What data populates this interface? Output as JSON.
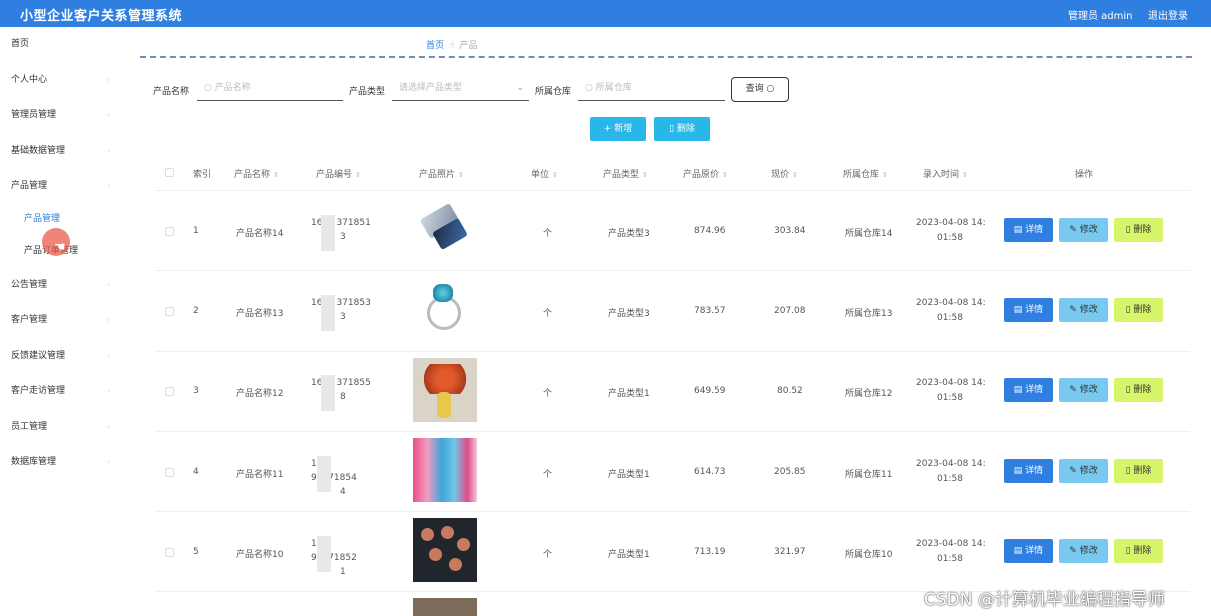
{
  "app": {
    "title": "小型企业客户关系管理系统",
    "admin_label": "管理员 admin",
    "logout_label": "退出登录"
  },
  "sidebar": {
    "items": [
      {
        "label": "首页"
      },
      {
        "label": "个人中心"
      },
      {
        "label": "管理员管理"
      },
      {
        "label": "基础数据管理"
      },
      {
        "label": "产品管理"
      },
      {
        "label": "产品管理"
      },
      {
        "label": "产品订单管理"
      },
      {
        "label": "公告管理"
      },
      {
        "label": "客户管理"
      },
      {
        "label": "反馈建议管理"
      },
      {
        "label": "客户走访管理"
      },
      {
        "label": "员工管理"
      },
      {
        "label": "数据库管理"
      }
    ]
  },
  "breadcrumb": {
    "home": "首页",
    "separator_icon": "hand-icon",
    "current": "产品"
  },
  "filters": {
    "name_label": "产品名称",
    "name_placeholder": "产品名称",
    "type_label": "产品类型",
    "type_placeholder": "请选择产品类型",
    "warehouse_label": "所属仓库",
    "warehouse_placeholder": "所属仓库",
    "query_label": "查询"
  },
  "actions": {
    "add_label": "新增",
    "batch_delete_label": "删除"
  },
  "table": {
    "headers": [
      "索引",
      "产品名称",
      "产品编号",
      "产品照片",
      "单位",
      "产品类型",
      "产品原价",
      "现价",
      "所属仓库",
      "录入时间",
      "操作"
    ],
    "rows": [
      {
        "index": "1",
        "name": "产品名称14",
        "code_a": "16",
        "code_b": "371851",
        "code_c": "3",
        "unit": "个",
        "type": "产品类型3",
        "orig_price": "874.96",
        "price": "303.84",
        "warehouse": "所属仓库14",
        "time_a": "2023-04-08 14:",
        "time_b": "01:58"
      },
      {
        "index": "2",
        "name": "产品名称13",
        "code_a": "16",
        "code_b": "371853",
        "code_c": "3",
        "unit": "个",
        "type": "产品类型3",
        "orig_price": "783.57",
        "price": "207.08",
        "warehouse": "所属仓库13",
        "time_a": "2023-04-08 14:",
        "time_b": "01:58"
      },
      {
        "index": "3",
        "name": "产品名称12",
        "code_a": "16",
        "code_b": "371855",
        "code_c": "8",
        "unit": "个",
        "type": "产品类型1",
        "orig_price": "649.59",
        "price": "80.52",
        "warehouse": "所属仓库12",
        "time_a": "2023-04-08 14:",
        "time_b": "01:58"
      },
      {
        "index": "4",
        "name": "产品名称11",
        "code_a": "1",
        "code_b": "93371854",
        "code_c": "4",
        "unit": "个",
        "type": "产品类型1",
        "orig_price": "614.73",
        "price": "205.85",
        "warehouse": "所属仓库11",
        "time_a": "2023-04-08 14:",
        "time_b": "01:58"
      },
      {
        "index": "5",
        "name": "产品名称10",
        "code_a": "1",
        "code_b": "93371852",
        "code_c": "1",
        "unit": "个",
        "type": "产品类型1",
        "orig_price": "713.19",
        "price": "321.97",
        "warehouse": "所属仓库10",
        "time_a": "2023-04-08 14:",
        "time_b": "01:58"
      }
    ],
    "op_detail": "详情",
    "op_edit": "修改",
    "op_delete": "删除"
  },
  "watermark": "CSDN @计算机毕业编程指导师",
  "colors": {
    "topbar": "#2e7fe0",
    "primary_btn": "#29b6e8",
    "detail_btn": "#2e7fe0",
    "edit_btn": "#78c9f0",
    "delete_btn": "#d7f56a"
  }
}
